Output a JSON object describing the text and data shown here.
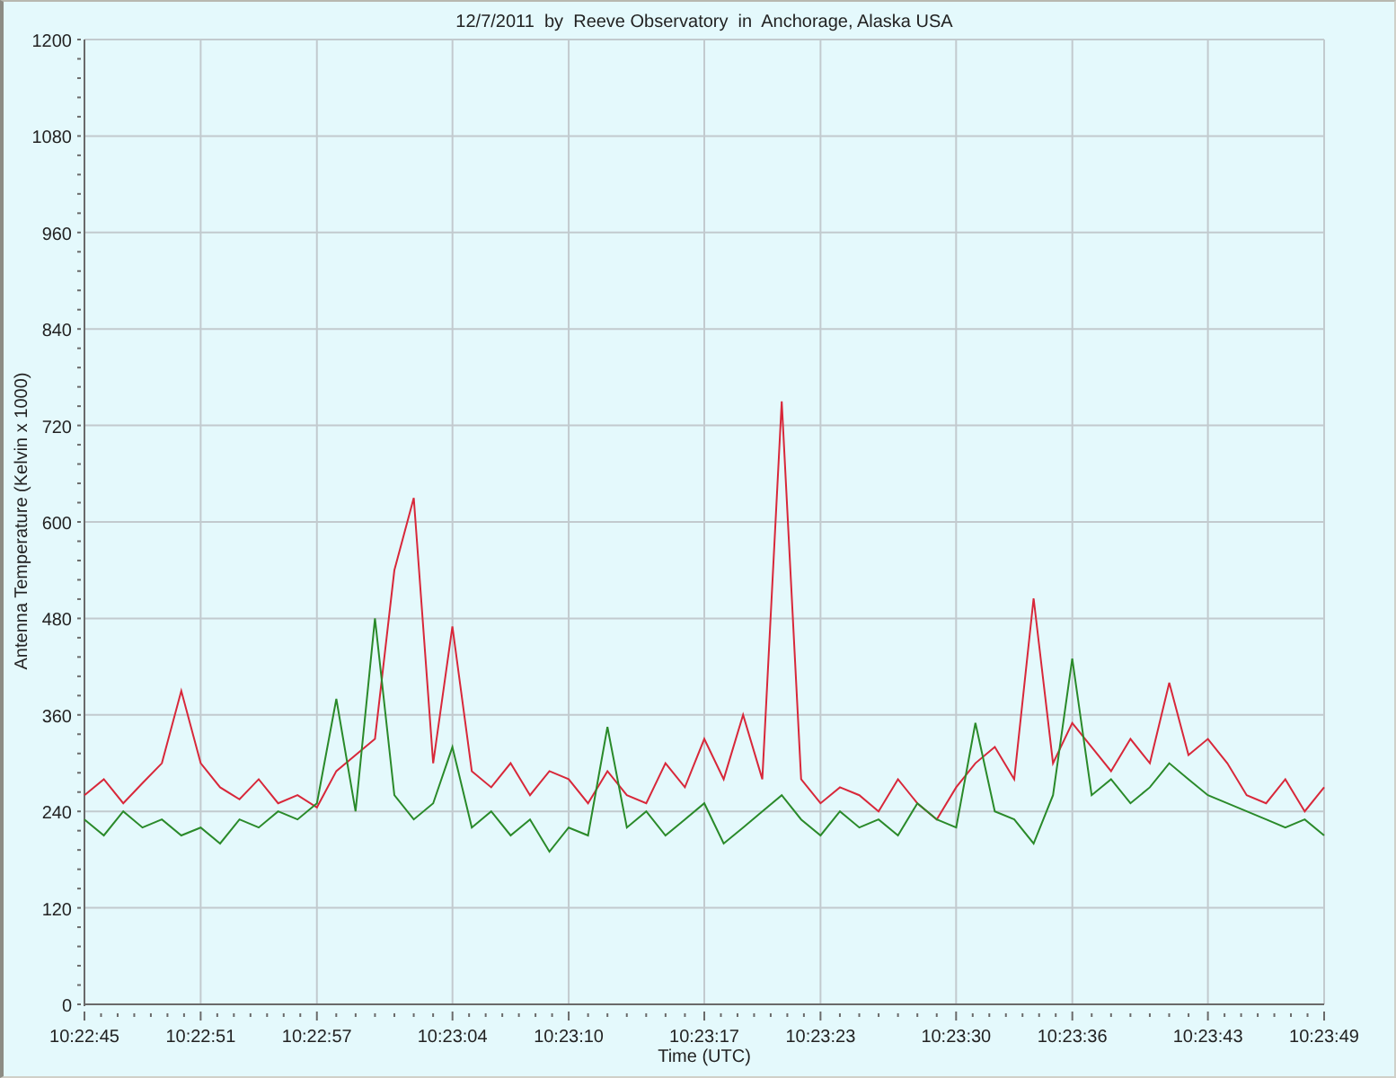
{
  "chart": {
    "chart_data": {
      "type": "line",
      "title": "12/7/2011  by  Reeve Observatory  in  Anchorage, Alaska USA",
      "xlabel": "Time (UTC)",
      "ylabel": "Antenna Temperature (Kelvin x 1000)",
      "x": [
        37365,
        37366,
        37367,
        37368,
        37369,
        37370,
        37371,
        37372,
        37373,
        37374,
        37375,
        37376,
        37377,
        37378,
        37379,
        37380,
        37381,
        37382,
        37383,
        37384,
        37385,
        37386,
        37387,
        37388,
        37389,
        37390,
        37391,
        37392,
        37393,
        37394,
        37395,
        37396,
        37397,
        37398,
        37399,
        37400,
        37401,
        37402,
        37403,
        37404,
        37405,
        37406,
        37407,
        37408,
        37409,
        37410,
        37411,
        37412,
        37413,
        37414,
        37415,
        37416,
        37417,
        37418,
        37419,
        37420,
        37421,
        37422,
        37423,
        37424,
        37425,
        37426,
        37427,
        37428,
        37429
      ],
      "series": [
        {
          "color": "#d8283a",
          "values": [
            260,
            280,
            250,
            275,
            300,
            390,
            300,
            270,
            255,
            280,
            250,
            260,
            245,
            290,
            310,
            330,
            540,
            630,
            300,
            470,
            290,
            270,
            300,
            260,
            290,
            280,
            250,
            290,
            260,
            250,
            300,
            270,
            330,
            280,
            360,
            280,
            750,
            280,
            250,
            270,
            260,
            240,
            280,
            250,
            230,
            270,
            300,
            320,
            280,
            505,
            300,
            350,
            320,
            290,
            330,
            300,
            400,
            310,
            330,
            300,
            260,
            250,
            280,
            240,
            270
          ]
        },
        {
          "color": "#2a8a2a",
          "values": [
            230,
            210,
            240,
            220,
            230,
            210,
            220,
            200,
            230,
            220,
            240,
            230,
            250,
            380,
            240,
            480,
            260,
            230,
            250,
            320,
            220,
            240,
            210,
            230,
            190,
            220,
            210,
            345,
            220,
            240,
            210,
            230,
            250,
            200,
            220,
            240,
            260,
            230,
            210,
            240,
            220,
            230,
            210,
            250,
            230,
            220,
            350,
            240,
            230,
            200,
            260,
            430,
            260,
            280,
            250,
            270,
            300,
            280,
            260,
            250,
            240,
            230,
            220,
            230,
            210
          ]
        }
      ],
      "xlim": [
        37365,
        37429
      ],
      "ylim": [
        0,
        1200
      ],
      "grid": true,
      "xticks": [
        {
          "value": 37365,
          "label": "10:22:45"
        },
        {
          "value": 37371,
          "label": "10:22:51"
        },
        {
          "value": 37377,
          "label": "10:22:57"
        },
        {
          "value": 37384,
          "label": "10:23:04"
        },
        {
          "value": 37390,
          "label": "10:23:10"
        },
        {
          "value": 37397,
          "label": "10:23:17"
        },
        {
          "value": 37403,
          "label": "10:23:23"
        },
        {
          "value": 37410,
          "label": "10:23:30"
        },
        {
          "value": 37416,
          "label": "10:23:36"
        },
        {
          "value": 37423,
          "label": "10:23:43"
        },
        {
          "value": 37429,
          "label": "10:23:49"
        }
      ],
      "yticks": [
        0,
        120,
        240,
        360,
        480,
        600,
        720,
        840,
        960,
        1080,
        1200
      ]
    }
  }
}
